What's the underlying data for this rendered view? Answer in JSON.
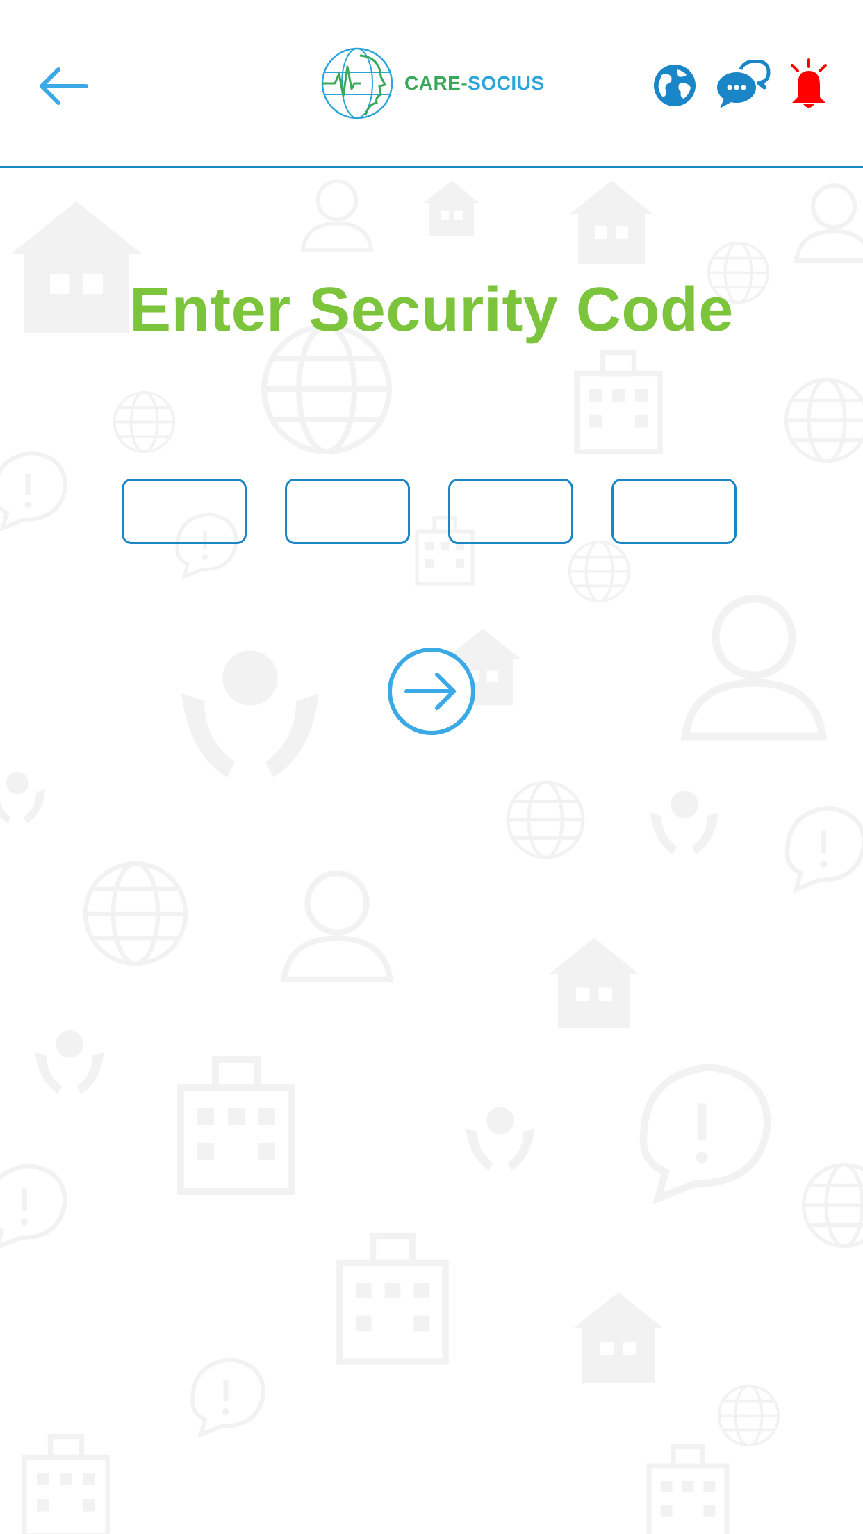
{
  "header": {
    "logo_text_part1": "CARE-",
    "logo_text_part2": "SOCIUS"
  },
  "main": {
    "title": "Enter Security Code",
    "code_inputs": [
      {
        "value": ""
      },
      {
        "value": ""
      },
      {
        "value": ""
      },
      {
        "value": ""
      }
    ]
  },
  "colors": {
    "primary_blue": "#1a86c8",
    "light_blue": "#3aa9e6",
    "title_green": "#7cc43b",
    "alarm_red": "#ff0000"
  },
  "icons": {
    "back": "arrow-left-icon",
    "globe": "globe-icon",
    "chat": "chat-bubbles-icon",
    "alarm": "alarm-bell-icon",
    "submit": "arrow-right-circle-icon"
  }
}
